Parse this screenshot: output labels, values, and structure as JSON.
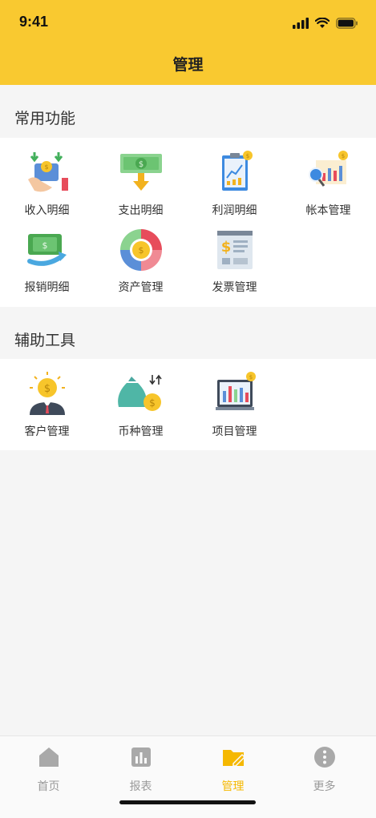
{
  "status_bar": {
    "time": "9:41"
  },
  "header": {
    "title": "管理"
  },
  "sections": [
    {
      "title": "常用功能",
      "items": [
        {
          "label": "收入明细",
          "icon": "income-icon"
        },
        {
          "label": "支出明细",
          "icon": "expense-icon"
        },
        {
          "label": "利润明细",
          "icon": "profit-icon"
        },
        {
          "label": "帐本管理",
          "icon": "ledger-icon"
        },
        {
          "label": "报销明细",
          "icon": "reimbursement-icon"
        },
        {
          "label": "资产管理",
          "icon": "assets-icon"
        },
        {
          "label": "发票管理",
          "icon": "invoice-icon"
        }
      ]
    },
    {
      "title": "辅助工具",
      "items": [
        {
          "label": "客户管理",
          "icon": "customer-icon"
        },
        {
          "label": "币种管理",
          "icon": "currency-icon"
        },
        {
          "label": "项目管理",
          "icon": "project-icon"
        }
      ]
    }
  ],
  "tabbar": {
    "items": [
      {
        "label": "首页",
        "icon": "home-icon",
        "active": false
      },
      {
        "label": "报表",
        "icon": "report-icon",
        "active": false
      },
      {
        "label": "管理",
        "icon": "manage-icon",
        "active": true
      },
      {
        "label": "更多",
        "icon": "more-icon",
        "active": false
      }
    ]
  },
  "colors": {
    "accent": "#f9c930",
    "active_tab": "#f5b800",
    "inactive_tab": "#9a9a9a"
  }
}
